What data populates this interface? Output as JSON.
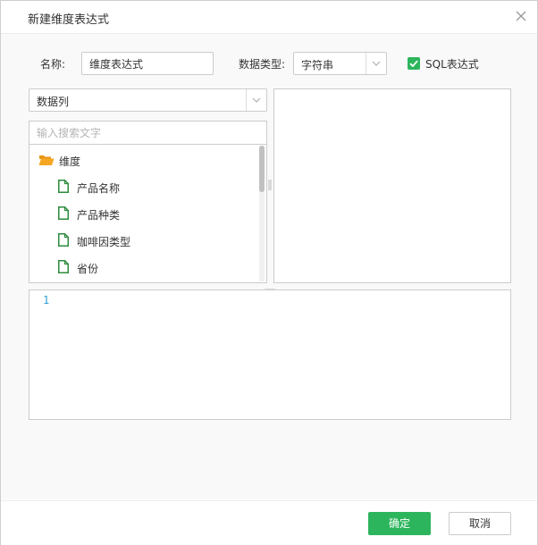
{
  "dialog": {
    "title": "新建维度表达式"
  },
  "form": {
    "name_label": "名称:",
    "name_value": "维度表达式",
    "type_label": "数据类型:",
    "type_value": "字符串",
    "sql_label": "SQL表达式",
    "sql_checked": true
  },
  "left_panel": {
    "source_select": "数据列",
    "search_placeholder": "输入搜索文字",
    "tree": {
      "folder": "维度",
      "items": [
        "产品名称",
        "产品种类",
        "咖啡因类型",
        "省份"
      ]
    }
  },
  "editor": {
    "line_numbers": [
      "1"
    ]
  },
  "footer": {
    "ok_label": "确定",
    "cancel_label": "取消"
  },
  "colors": {
    "accent": "#2db55d",
    "folder": "#f5a623",
    "file_icon": "#2e8b3e",
    "line_number": "#2e9fd6"
  },
  "icons": {
    "close": "close-icon",
    "folder": "folder-open-icon",
    "file": "file-icon",
    "check": "check-icon",
    "chevron": "chevron-down-icon"
  }
}
